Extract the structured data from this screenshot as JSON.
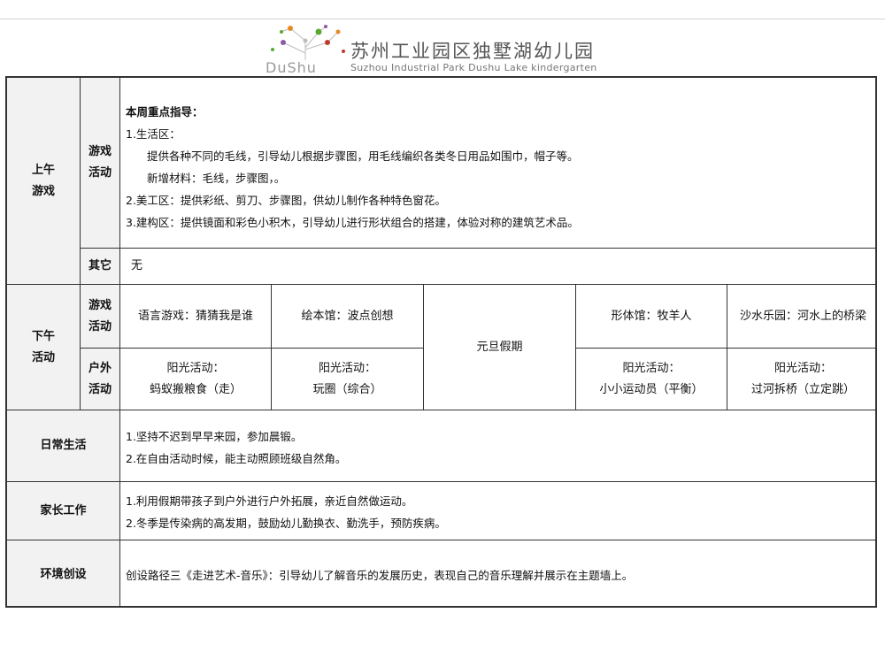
{
  "header": {
    "logo_text": "DuShu",
    "school_name": "苏州工业园区独墅湖幼儿园",
    "school_name_en": "Suzhou Industrial Park Dushu Lake kindergarten",
    "colors": {
      "orange": "#e58a25",
      "green": "#5aa832",
      "red": "#c0392b",
      "purple": "#8a5aa6",
      "gray": "#9a9a9a"
    }
  },
  "am": {
    "label_line1": "上午",
    "label_line2": "游戏",
    "game_label_line1": "游戏",
    "game_label_line2": "活动",
    "focus_title": "本周重点指导：",
    "lines": [
      "1.生活区：",
      "提供各种不同的毛线，引导幼儿根据步骤图，用毛线编织各类冬日用品如围巾，帽子等。",
      "新增材料：毛线，步骤图，。",
      "2.美工区：提供彩纸、剪刀、步骤图，供幼儿制作各种特色窗花。",
      "3.建构区：提供镜面和彩色小积木，引导幼儿进行形状组合的搭建，体验对称的建筑艺术品。"
    ],
    "other_label": "其它",
    "other_value": "无"
  },
  "pm": {
    "label_line1": "下午",
    "label_line2": "活动",
    "game_label_line1": "游戏",
    "game_label_line2": "活动",
    "outdoor_label_line1": "户外",
    "outdoor_label_line2": "活动",
    "games": [
      "语言游戏：猜猜我是谁",
      "绘本馆：波点创想",
      "形体馆：牧羊人",
      "沙水乐园：河水上的桥梁"
    ],
    "holiday": "元旦假期",
    "outdoor": [
      {
        "line1": "阳光活动：",
        "line2": "蚂蚁搬粮食（走）"
      },
      {
        "line1": "阳光活动：",
        "line2": "玩圈（综合）"
      },
      {
        "line1": "阳光活动：",
        "line2": "小小运动员（平衡）"
      },
      {
        "line1": "阳光活动：",
        "line2": "过河拆桥（立定跳）"
      }
    ]
  },
  "daily": {
    "label": "日常生活",
    "lines": [
      "1.坚持不迟到早早来园，参加晨锻。",
      "2.在自由活动时候，能主动照顾班级自然角。"
    ]
  },
  "parents": {
    "label": "家长工作",
    "lines": [
      "1.利用假期带孩子到户外进行户外拓展，亲近自然做运动。",
      "2.冬季是传染病的高发期，鼓励幼儿勤换衣、勤洗手，预防疾病。"
    ]
  },
  "environment": {
    "label": "环境创设",
    "value": "创设路径三《走进艺术-音乐》：引导幼儿了解音乐的发展历史，表现自己的音乐理解并展示在主题墙上。"
  }
}
